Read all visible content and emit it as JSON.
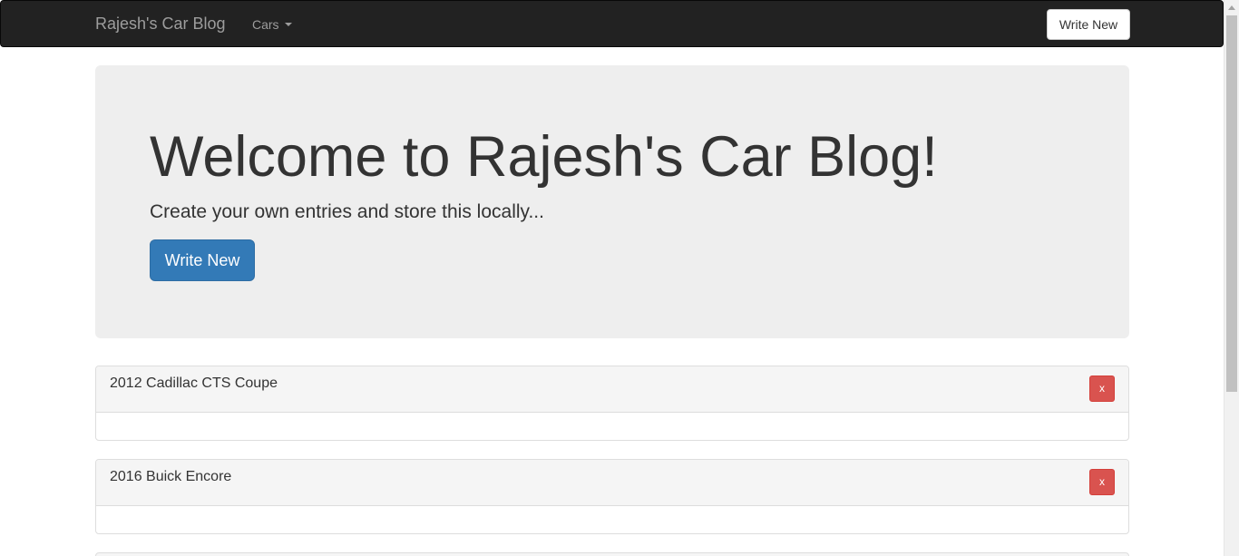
{
  "navbar": {
    "brand": "Rajesh's Car Blog",
    "dropdown_label": "Cars",
    "write_new_label": "Write New"
  },
  "jumbotron": {
    "title": "Welcome to Rajesh's Car Blog!",
    "subtitle": "Create your own entries and store this locally...",
    "button_label": "Write New"
  },
  "entries": [
    {
      "title": "2012 Cadillac CTS Coupe",
      "delete_label": "x"
    },
    {
      "title": "2016 Buick Encore",
      "delete_label": "x"
    }
  ],
  "colors": {
    "navbar_bg": "#222222",
    "primary": "#337ab7",
    "danger": "#d9534f",
    "jumbotron_bg": "#eeeeee"
  }
}
